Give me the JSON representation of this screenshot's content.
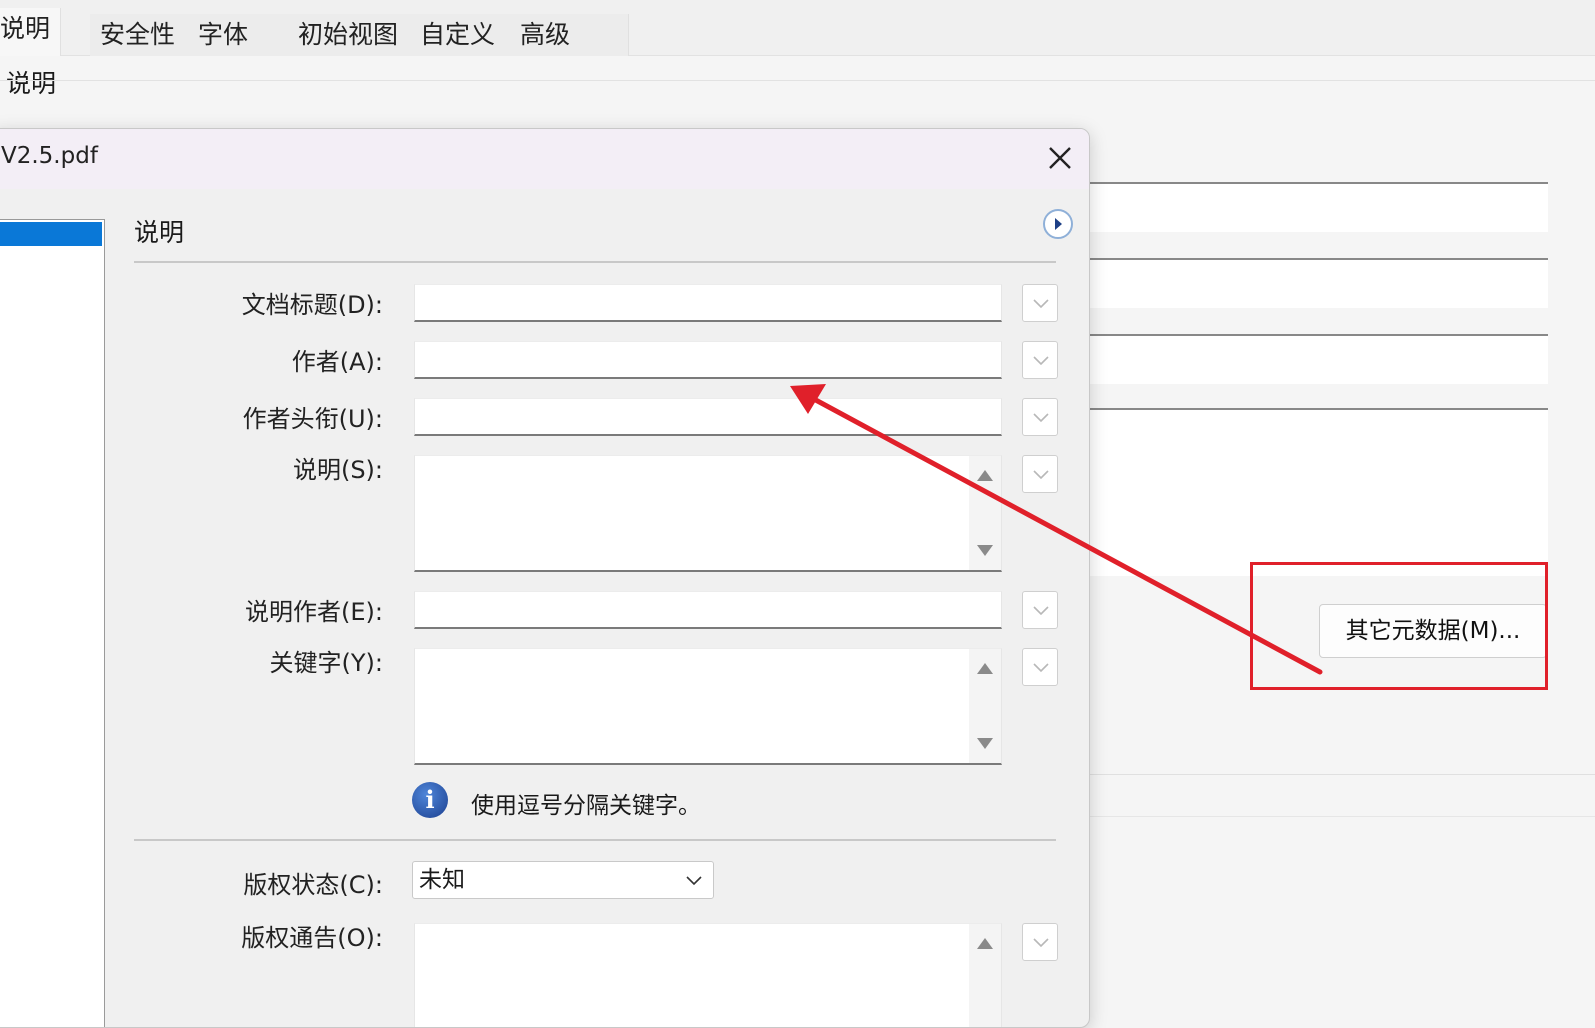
{
  "background_window": {
    "tabs": [
      {
        "label": "说明",
        "active": true
      },
      {
        "label": "安全性",
        "active": false
      },
      {
        "label": "字体",
        "active": false
      },
      {
        "label": "初始视图",
        "active": false
      },
      {
        "label": "自定义",
        "active": false
      },
      {
        "label": "高级",
        "active": false
      }
    ],
    "section_title": "说明",
    "more_metadata_button": "其它元数据(M)..."
  },
  "dialog": {
    "title": "V2.5.pdf",
    "section_title": "说明",
    "fields": {
      "doc_title": {
        "label": "文档标题(D):",
        "value": ""
      },
      "author": {
        "label": "作者(A):",
        "value": ""
      },
      "author_title": {
        "label": "作者头衔(U):",
        "value": ""
      },
      "description": {
        "label": "说明(S):",
        "value": ""
      },
      "description_author": {
        "label": "说明作者(E):",
        "value": ""
      },
      "keywords": {
        "label": "关键字(Y):",
        "value": ""
      },
      "copyright_status": {
        "label": "版权状态(C):",
        "value": "未知"
      },
      "copyright_notice": {
        "label": "版权通告(O):",
        "value": ""
      }
    },
    "keywords_hint": "使用逗号分隔关键字。"
  },
  "annotation": {
    "color": "#e0202a",
    "arrow_icon": "red-arrow",
    "highlight": "red-rectangle"
  },
  "colors": {
    "selection_blue": "#0a78d7"
  }
}
